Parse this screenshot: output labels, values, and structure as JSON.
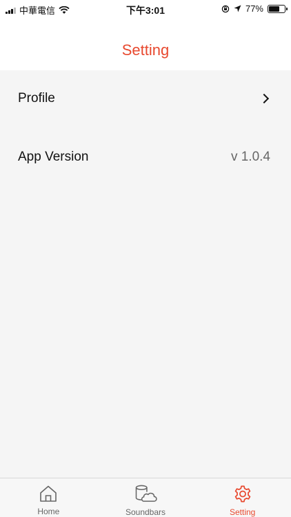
{
  "status_bar": {
    "carrier": "中華電信",
    "time": "下午3:01",
    "battery_percent": "77%",
    "battery_level": 0.77,
    "icons": [
      "signal-icon",
      "wifi-icon",
      "orientation-lock-icon",
      "location-icon",
      "battery-icon"
    ]
  },
  "header": {
    "title": "Setting"
  },
  "settings": {
    "profile": {
      "label": "Profile",
      "icon": "chevron-right-icon"
    },
    "app_version": {
      "label": "App Version",
      "value": "v 1.0.4"
    }
  },
  "tabbar": {
    "tabs": [
      {
        "label": "Home",
        "icon": "home-icon",
        "active": false
      },
      {
        "label": "Soundbars",
        "icon": "soundbar-cloud-icon",
        "active": false
      },
      {
        "label": "Setting",
        "icon": "gear-icon",
        "active": true
      }
    ]
  },
  "colors": {
    "accent": "#e8492f",
    "background": "#f5f5f5",
    "inactive_tab": "#666666"
  }
}
